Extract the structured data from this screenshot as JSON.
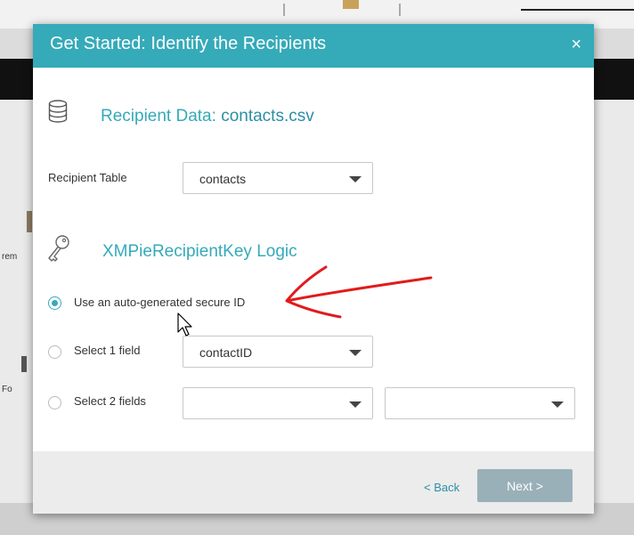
{
  "background": {
    "side_label_1": "rem",
    "side_label_2": "Fo"
  },
  "dialog": {
    "title": "Get Started: Identify the Recipients",
    "close_label": "×",
    "recipient_data": {
      "heading_prefix": "Recipient Data: ",
      "heading_file": "contacts.csv",
      "icon": "database-icon"
    },
    "recipient_table": {
      "label": "Recipient Table",
      "selected": "contacts"
    },
    "key_logic": {
      "heading": "XMPieRecipientKey Logic",
      "icon": "key-icon",
      "options": [
        {
          "label": "Use an auto-generated secure ID",
          "checked": true
        },
        {
          "label": "Select 1 field",
          "checked": false,
          "field_value": "contactID"
        },
        {
          "label": "Select 2 fields",
          "checked": false,
          "field_value_1": "",
          "field_value_2": ""
        }
      ]
    },
    "footer": {
      "back_label": "< Back",
      "next_label": "Next >"
    }
  },
  "colors": {
    "accent": "#35aab9",
    "annotation": "#e11b1b",
    "next_button": "#9ab0b8"
  }
}
